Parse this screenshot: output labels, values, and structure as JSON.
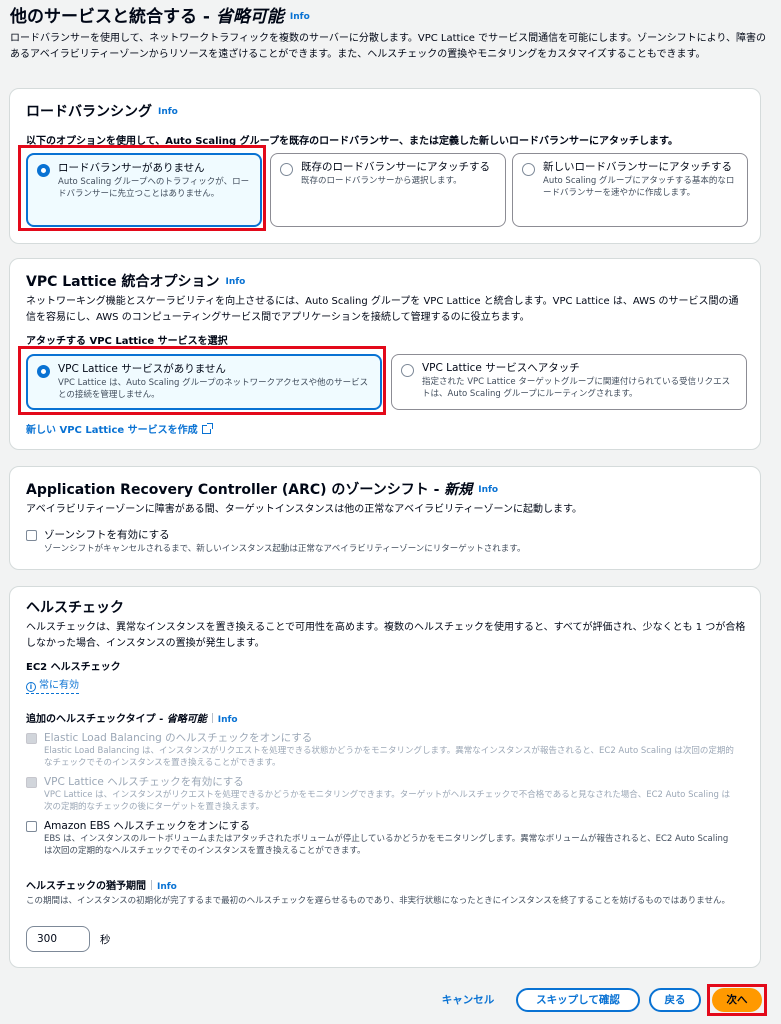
{
  "header": {
    "title": "他のサービスと統合する - ",
    "title_optional": "省略可能",
    "info": "Info",
    "description": "ロードバランサーを使用して、ネットワークトラフィックを複数のサーバーに分散します。VPC Lattice でサービス間通信を可能にします。ゾーンシフトにより、障害のあるアベイラビリティーゾーンからリソースを遠ざけることができます。また、ヘルスチェックの置換やモニタリングをカスタマイズすることもできます。"
  },
  "load_balancing": {
    "title": "ロードバランシング",
    "info": "Info",
    "subheading": "以下のオプションを使用して、Auto Scaling グループを既存のロードバランサー、または定義した新しいロードバランサーにアタッチします。",
    "options": [
      {
        "title": "ロードバランサーがありません",
        "desc": "Auto Scaling グループへのトラフィックが、ロードバランサーに先立つことはありません。"
      },
      {
        "title": "既存のロードバランサーにアタッチする",
        "desc": "既存のロードバランサーから選択します。"
      },
      {
        "title": "新しいロードバランサーにアタッチする",
        "desc": "Auto Scaling グループにアタッチする基本的なロードバランサーを速やかに作成します。"
      }
    ]
  },
  "vpc_lattice": {
    "title": "VPC Lattice 統合オプション",
    "info": "Info",
    "description": "ネットワーキング機能とスケーラビリティを向上させるには、Auto Scaling グループを VPC Lattice と統合します。VPC Lattice は、AWS のサービス間の通信を容易にし、AWS のコンピューティングサービス間でアプリケーションを接続して管理するのに役立ちます。",
    "subheading": "アタッチする VPC Lattice サービスを選択",
    "options": [
      {
        "title": "VPC Lattice サービスがありません",
        "desc": "VPC Lattice は、Auto Scaling グループのネットワークアクセスや他のサービスとの接続を管理しません。"
      },
      {
        "title": "VPC Lattice サービスへアタッチ",
        "desc": "指定された VPC Lattice ターゲットグループに関連付けられている受信リクエストは、Auto Scaling グループにルーティングされます。"
      }
    ],
    "create_link": "新しい VPC Lattice サービスを作成"
  },
  "arc": {
    "title": "Application Recovery Controller (ARC) のゾーンシフト - ",
    "title_new": "新規",
    "info": "Info",
    "description": "アベイラビリティーゾーンに障害がある間、ターゲットインスタンスは他の正常なアベイラビリティーゾーンに起動します。",
    "checkbox_label": "ゾーンシフトを有効にする",
    "checkbox_desc": "ゾーンシフトがキャンセルされるまで、新しいインスタンス起動は正常なアベイラビリティーゾーンにリターゲットされます。"
  },
  "health": {
    "title": "ヘルスチェック",
    "description": "ヘルスチェックは、異常なインスタンスを置き換えることで可用性を高めます。複数のヘルスチェックを使用すると、すべてが評価され、少なくとも 1 つが合格しなかった場合、インスタンスの置換が発生します。",
    "ec2_heading": "EC2 ヘルスチェック",
    "always_on": "常に有効",
    "additional_heading": "追加のヘルスチェックタイプ - ",
    "additional_optional": "省略可能",
    "info": "Info",
    "checks": [
      {
        "title": "Elastic Load Balancing のヘルスチェックをオンにする",
        "desc": "Elastic Load Balancing は、インスタンスがリクエストを処理できる状態かどうかをモニタリングします。異常なインスタンスが報告されると、EC2 Auto Scaling は次回の定期的なチェックでそのインスタンスを置き換えることができます。"
      },
      {
        "title": "VPC Lattice ヘルスチェックを有効にする",
        "desc": "VPC Lattice は、インスタンスがリクエストを処理できるかどうかをモニタリングできます。ターゲットがヘルスチェックで不合格であると見なされた場合、EC2 Auto Scaling は次の定期的なチェックの後にターゲットを置き換えます。"
      },
      {
        "title": "Amazon EBS ヘルスチェックをオンにする",
        "desc": "EBS は、インスタンスのルートボリュームまたはアタッチされたボリュームが停止しているかどうかをモニタリングします。異常なボリュームが報告されると、EC2 Auto Scaling は次回の定期的なヘルスチェックでそのインスタンスを置き換えることができます。"
      }
    ],
    "grace_heading": "ヘルスチェックの猶予期間",
    "grace_desc": "この期間は、インスタンスの初期化が完了するまで最初のヘルスチェックを遅らせるものであり、非実行状態になったときにインスタンスを終了することを妨げるものではありません。",
    "grace_value": "300",
    "grace_unit": "秒"
  },
  "footer": {
    "cancel": "キャンセル",
    "skip": "スキップして確認",
    "back": "戻る",
    "next": "次へ"
  }
}
